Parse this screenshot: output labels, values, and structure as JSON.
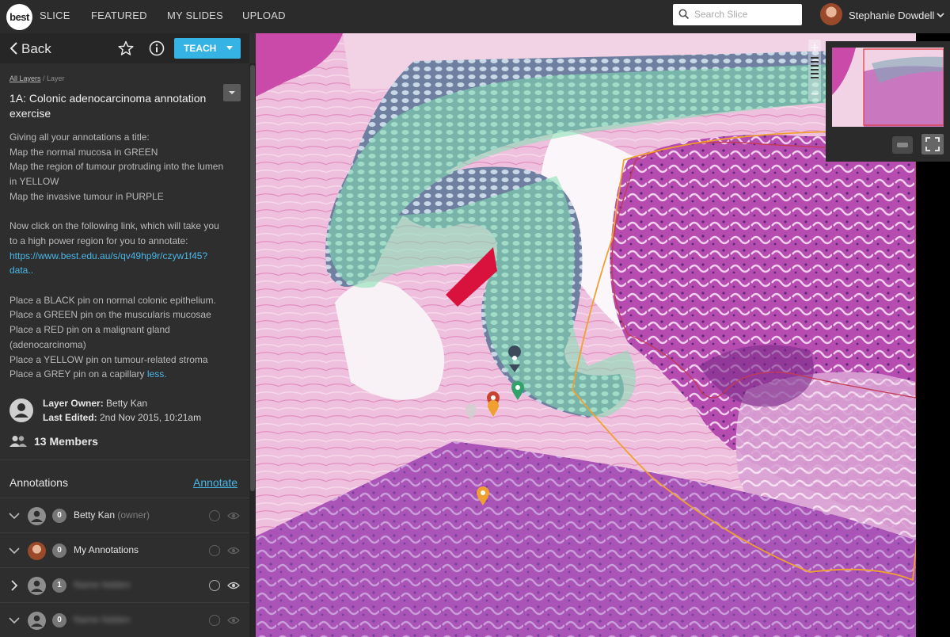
{
  "topbar": {
    "logo": "best",
    "nav": [
      "SLICE",
      "FEATURED",
      "MY SLIDES",
      "UPLOAD"
    ],
    "search_placeholder": "Search Slice",
    "user_name": "Stephanie Dowdell"
  },
  "sidebar": {
    "back_label": "Back",
    "teach_label": "TEACH",
    "breadcrumb_all": "All Layers",
    "breadcrumb_sep": " / ",
    "breadcrumb_current": "Layer",
    "layer_title": "1A: Colonic adenocarcinoma annotation exercise",
    "description_lines": [
      "Giving all your annotations a title:",
      "Map the normal mucosa in GREEN",
      "Map the region of tumour protruding into the lumen",
      "in YELLOW",
      "Map the invasive tumour in PURPLE",
      "",
      "Now click on the following link, which will take you",
      "to a high power region for you to annotate:"
    ],
    "link_line1": "https://www.best.edu.au/s/qv49hp9r/czyw1f45?",
    "link_line2": "data..",
    "pin_lines": [
      "Place a BLACK pin on normal colonic epithelium.",
      "Place a GREEN pin on the muscularis mucosae",
      "Place a RED pin on a malignant gland",
      "(adenocarcinoma)",
      "Place a YELLOW pin on tumour-related stroma"
    ],
    "last_pin_line": "Place a GREY pin on a capillary ",
    "less_link": "less.",
    "owner_label": "Layer Owner:",
    "owner_value": " Betty Kan",
    "edited_label": "Last Edited:",
    "edited_value": " 2nd Nov 2015, 10:21am",
    "members": "13 Members",
    "annotations_heading": "Annotations",
    "annotate_link": "Annotate",
    "annotation_rows": [
      {
        "count": "0",
        "name": "Betty Kan",
        "tag": " (owner)"
      },
      {
        "count": "0",
        "name": "My Annotations",
        "tag": ""
      },
      {
        "count": "1",
        "name": "Name hidden",
        "tag": ""
      },
      {
        "count": "0",
        "name": "Name hidden",
        "tag": ""
      }
    ]
  },
  "colors": {
    "accent": "#35b3e4",
    "normal_mucosa": "#7fe0b0",
    "invasive_tumour": "#9c5fc4",
    "tumour_outline": "#f0a030"
  }
}
